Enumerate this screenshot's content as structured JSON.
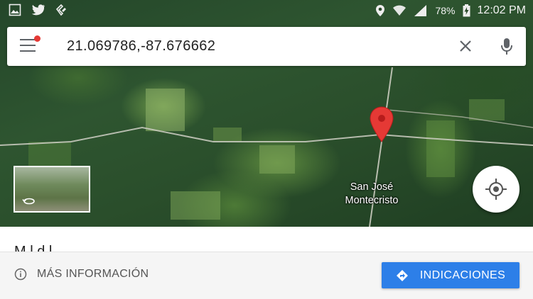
{
  "status_bar": {
    "left_icons": [
      "image-icon",
      "twitter-icon",
      "feedly-icon"
    ],
    "battery": "78%",
    "time": "12:02 PM"
  },
  "search": {
    "query": "21.069786,-87.676662"
  },
  "map": {
    "place_label_line1": "San José",
    "place_label_line2": "Montecristo"
  },
  "sheet": {
    "title_partial": "M    l       d   l    "
  },
  "actions": {
    "more_info": "MÁS INFORMACIÓN",
    "directions": "INDICACIONES"
  },
  "colors": {
    "accent": "#2d7fe8",
    "pin": "#e53935"
  }
}
